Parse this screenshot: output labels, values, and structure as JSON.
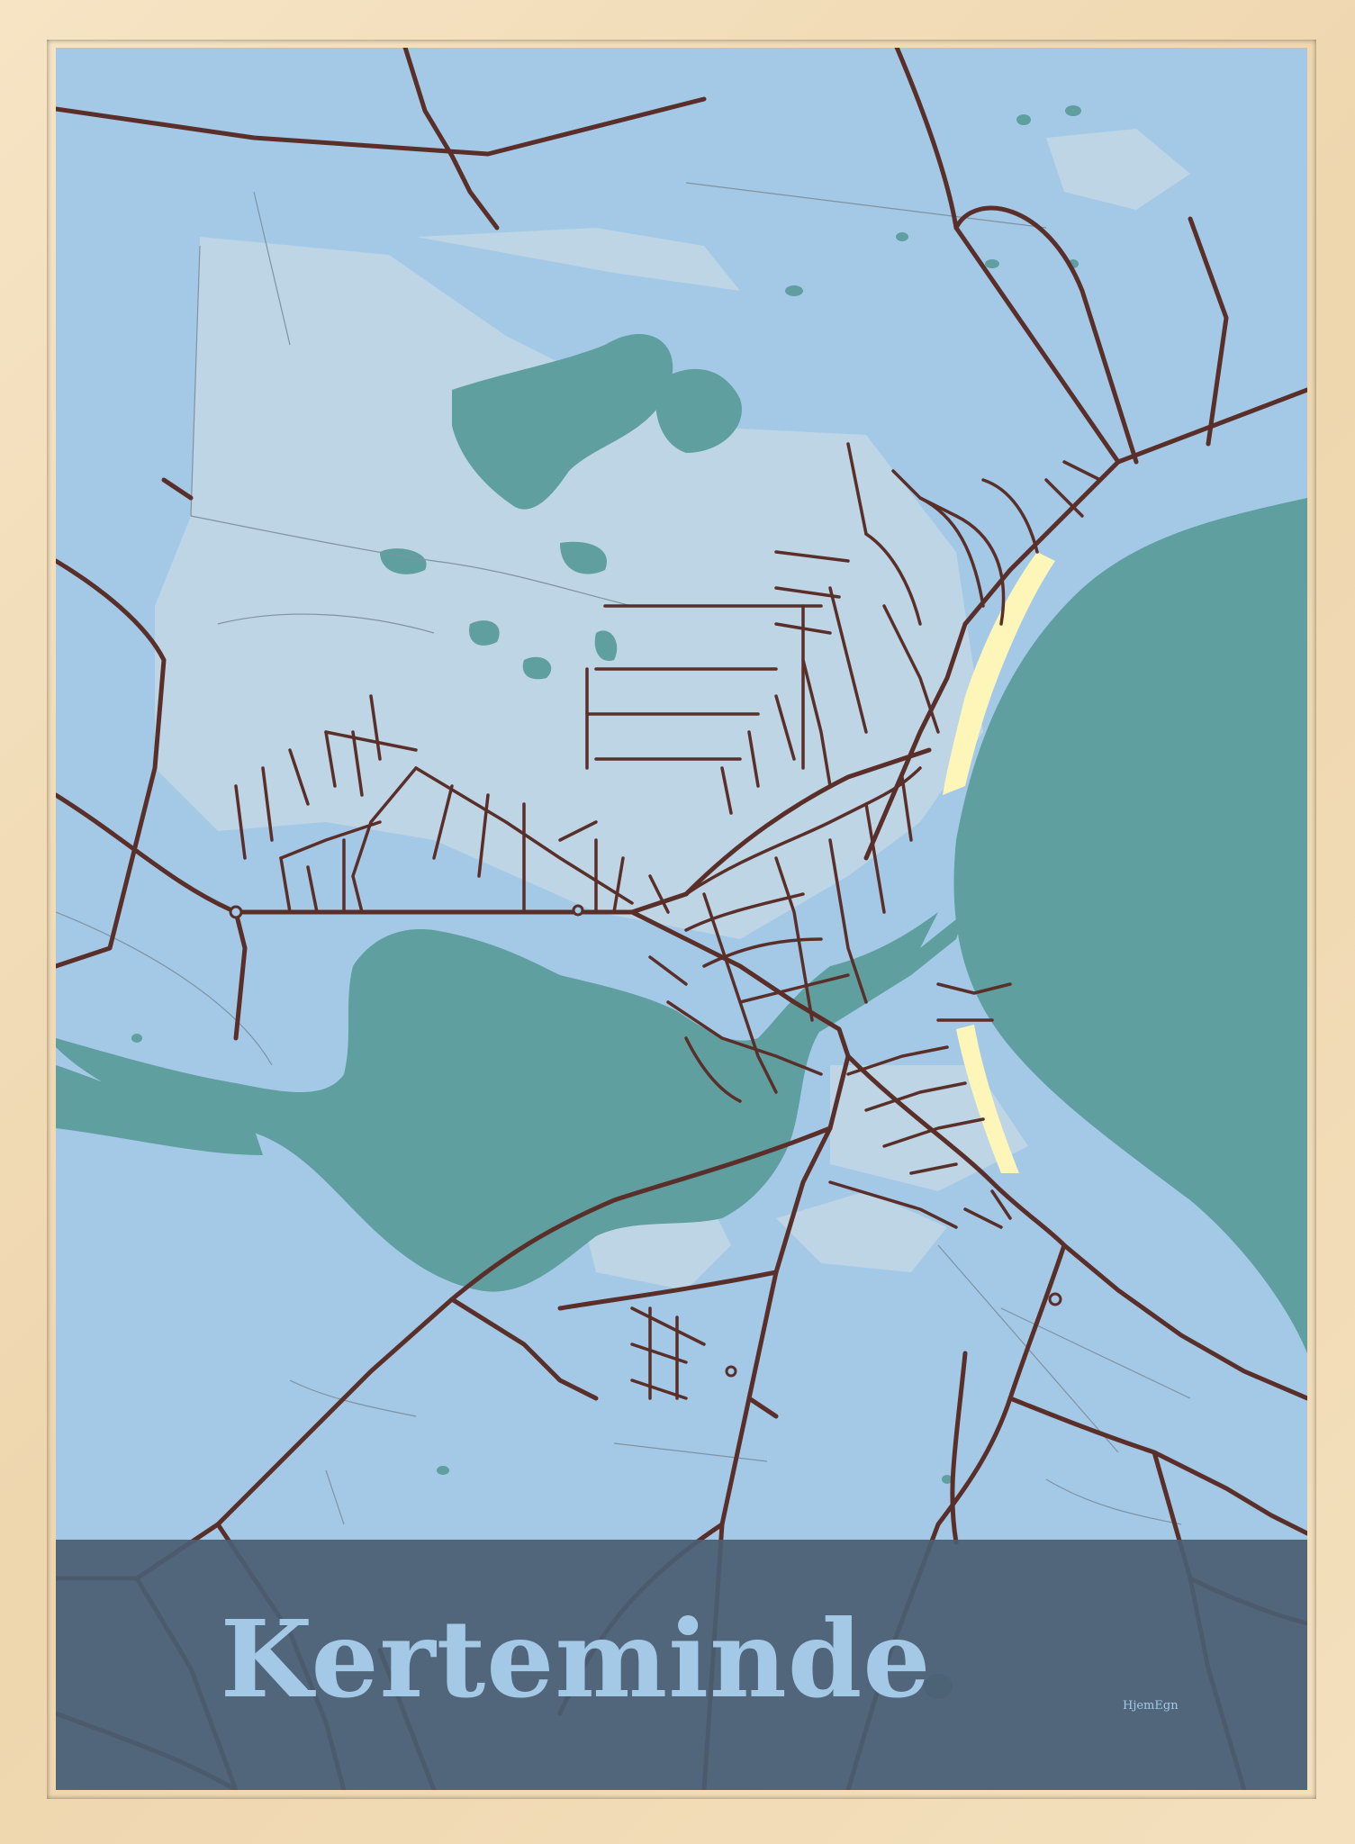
{
  "poster": {
    "title": "Kerteminde",
    "brand": "HjemEgn"
  },
  "colors": {
    "frame": "#f3dfbc",
    "land": "#a3c9e6",
    "built_area": "#bdd5e5",
    "water": "#5f9fa0",
    "beach": "#fdf6b8",
    "roads": "#5b2f29",
    "banner": "#4a5f72",
    "title_text": "#a3c9e6"
  },
  "icons": {
    "map": "street-map-illustration"
  }
}
